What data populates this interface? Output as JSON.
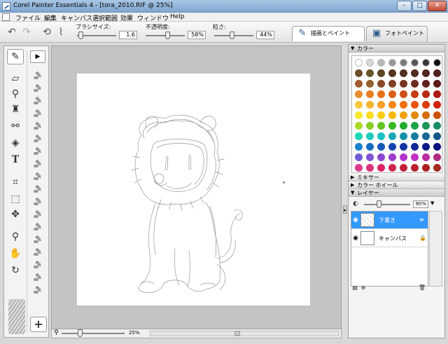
{
  "window": {
    "title": "Corel Painter Essentials 4 - [tora_2010.RIF @ 25%]",
    "minimize": "–",
    "maximize": "□",
    "close": "✕"
  },
  "menu": {
    "items": [
      "ファイル",
      "編集",
      "キャンバス",
      "選択範囲",
      "効果",
      "ウィンドウ",
      "Help"
    ]
  },
  "propbar": {
    "brush_size": {
      "label": "ブラシサイズ:",
      "value": "1.6",
      "level": 0.05
    },
    "opacity": {
      "label": "不透明度:",
      "value": "58%",
      "level": 0.58
    },
    "grain": {
      "label": "粒さ:",
      "value": "44%",
      "level": 0.44
    }
  },
  "mode_tabs": [
    {
      "label": "描画とペイント",
      "icon": "brush-hand-icon",
      "active": true
    },
    {
      "label": "フォトペイント",
      "icon": "photo-icon",
      "active": false
    }
  ],
  "statusbar": {
    "zoom": "25%",
    "zoom_level": 0.28
  },
  "panels": {
    "color": {
      "title": "カラー"
    },
    "mixer": {
      "title": "ミキサー"
    },
    "color_wheel": {
      "title": "カラー ホイール"
    },
    "layers": {
      "title": "レイヤー",
      "opacity": "90%",
      "opacity_level": 0.3,
      "items": [
        {
          "name": "下書き",
          "selected": true
        },
        {
          "name": "キャンバス",
          "selected": false
        }
      ]
    }
  },
  "colors": {
    "title_bar": "#8fb2d8",
    "selection": "#3399ff",
    "canvas_bg": "#c4c4c4"
  }
}
